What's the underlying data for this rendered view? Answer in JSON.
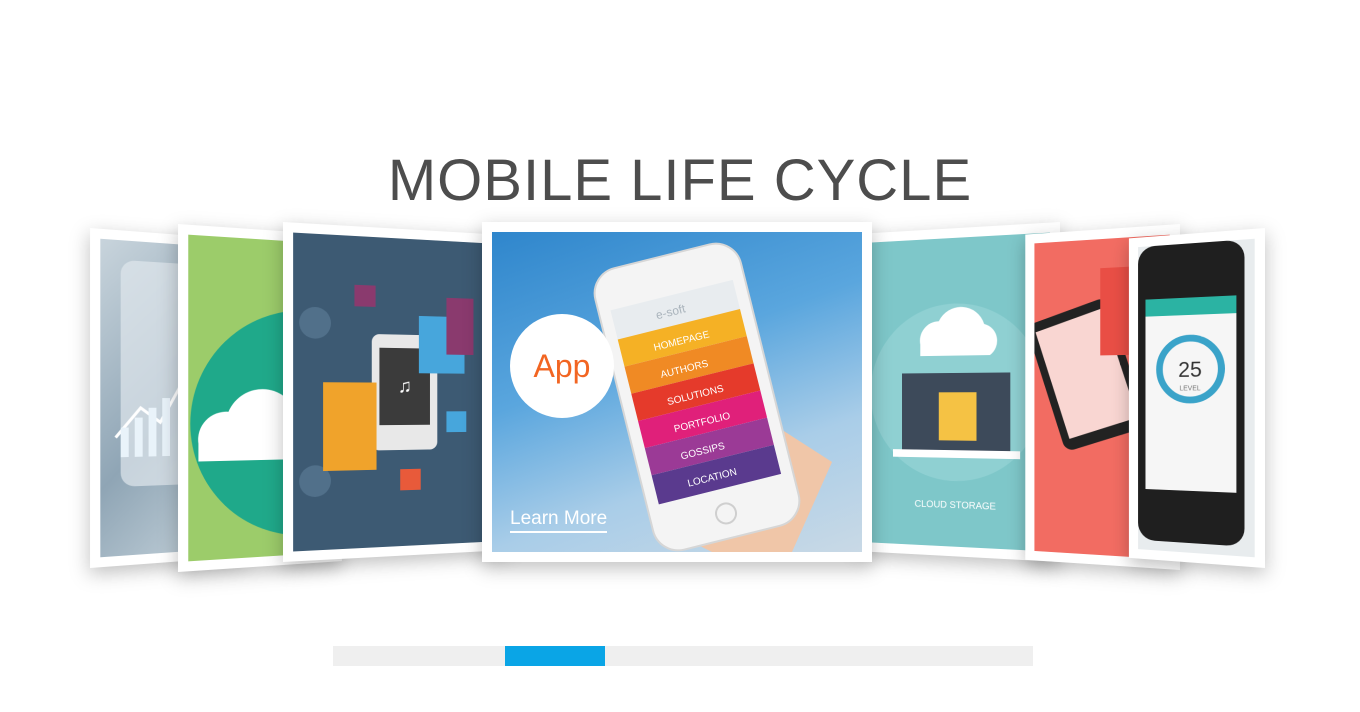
{
  "page": {
    "title": "MOBILE LIFE CYCLE"
  },
  "featured": {
    "badge": "App",
    "link": "Learn More",
    "phone_menu": [
      "HOMEPAGE",
      "AUTHORS",
      "SOLUTIONS",
      "PORTFOLIO",
      "GOSSIPS",
      "LOCATION"
    ],
    "phone_brand": "e-soft",
    "menu_colors": [
      "#f5b125",
      "#f08a24",
      "#e53a2b",
      "#e0207a",
      "#9b3a96",
      "#5a3a8e"
    ]
  },
  "cards": {
    "cloud_storage_label": "CLOUD STORAGE",
    "gauge_value": "25",
    "gauge_level": "LEVEL"
  },
  "colors": {
    "title": "#4d4d4d",
    "accent": "#0aa5e6",
    "app_text": "#f26522"
  },
  "scrollbar": {
    "position": 0.286
  }
}
